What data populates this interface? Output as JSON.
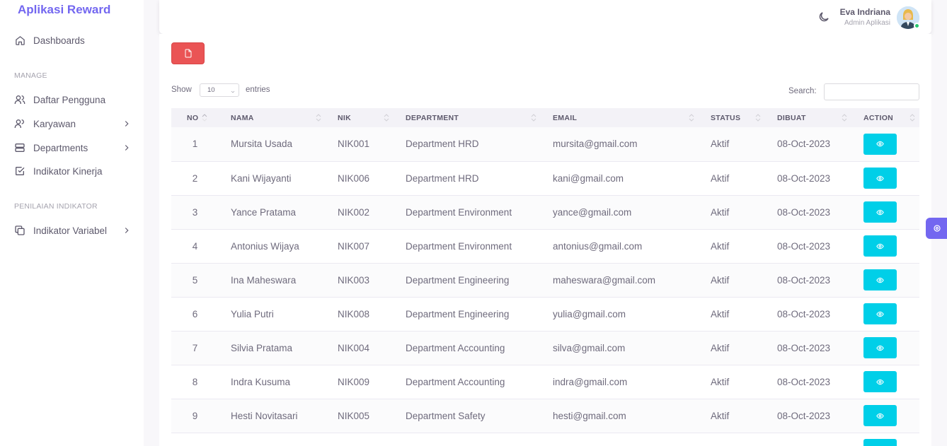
{
  "app": {
    "brand": "Aplikasi Reward"
  },
  "sidebar": {
    "dashboard": "Dashboards",
    "section_manage": "MANAGE",
    "items_manage": [
      {
        "label": "Daftar Pengguna",
        "icon": "users-icon",
        "has_submenu": false
      },
      {
        "label": "Karyawan",
        "icon": "user-icon",
        "has_submenu": true
      },
      {
        "label": "Departments",
        "icon": "server-icon",
        "has_submenu": true
      },
      {
        "label": "Indikator Kinerja",
        "icon": "checkbox-icon",
        "has_submenu": false
      }
    ],
    "section_penilaian": "PENILAIAN INDIKATOR",
    "items_penilaian": [
      {
        "label": "Indikator Variabel",
        "icon": "copy-icon",
        "has_submenu": true
      }
    ]
  },
  "navbar": {
    "user_name": "Eva Indriana",
    "user_role": "Admin Aplikasi"
  },
  "toolbar": {
    "pdf_icon": "pdf-file-icon"
  },
  "table_controls": {
    "show_label": "Show",
    "page_length": "10",
    "entries_label": "entries",
    "search_label": "Search:",
    "search_value": ""
  },
  "table": {
    "headers": [
      "NO",
      "NAMA",
      "NIK",
      "DEPARTMENT",
      "EMAIL",
      "STATUS",
      "DIBUAT",
      "ACTION"
    ],
    "rows": [
      {
        "no": "1",
        "nama": "Mursita Usada",
        "nik": "NIK001",
        "department": "Department HRD",
        "email": "mursita@gmail.com",
        "status": "Aktif",
        "dibuat": "08-Oct-2023"
      },
      {
        "no": "2",
        "nama": "Kani Wijayanti",
        "nik": "NIK006",
        "department": "Department HRD",
        "email": "kani@gmail.com",
        "status": "Aktif",
        "dibuat": "08-Oct-2023"
      },
      {
        "no": "3",
        "nama": "Yance Pratama",
        "nik": "NIK002",
        "department": "Department Environment",
        "email": "yance@gmail.com",
        "status": "Aktif",
        "dibuat": "08-Oct-2023"
      },
      {
        "no": "4",
        "nama": "Antonius Wijaya",
        "nik": "NIK007",
        "department": "Department Environment",
        "email": "antonius@gmail.com",
        "status": "Aktif",
        "dibuat": "08-Oct-2023"
      },
      {
        "no": "5",
        "nama": "Ina Maheswara",
        "nik": "NIK003",
        "department": "Department Engineering",
        "email": "maheswara@gmail.com",
        "status": "Aktif",
        "dibuat": "08-Oct-2023"
      },
      {
        "no": "6",
        "nama": "Yulia Putri",
        "nik": "NIK008",
        "department": "Department Engineering",
        "email": "yulia@gmail.com",
        "status": "Aktif",
        "dibuat": "08-Oct-2023"
      },
      {
        "no": "7",
        "nama": "Silvia Pratama",
        "nik": "NIK004",
        "department": "Department Accounting",
        "email": "silva@gmail.com",
        "status": "Aktif",
        "dibuat": "08-Oct-2023"
      },
      {
        "no": "8",
        "nama": "Indra Kusuma",
        "nik": "NIK009",
        "department": "Department Accounting",
        "email": "indra@gmail.com",
        "status": "Aktif",
        "dibuat": "08-Oct-2023"
      },
      {
        "no": "9",
        "nama": "Hesti Novitasari",
        "nik": "NIK005",
        "department": "Department Safety",
        "email": "hesti@gmail.com",
        "status": "Aktif",
        "dibuat": "08-Oct-2023"
      },
      {
        "no": "",
        "nama": "",
        "nik": "",
        "department": "",
        "email": "",
        "status": "",
        "dibuat": ""
      }
    ]
  },
  "colors": {
    "primary": "#7367f0",
    "danger": "#ea5455",
    "info": "#00cfe8",
    "success": "#28c76f"
  }
}
